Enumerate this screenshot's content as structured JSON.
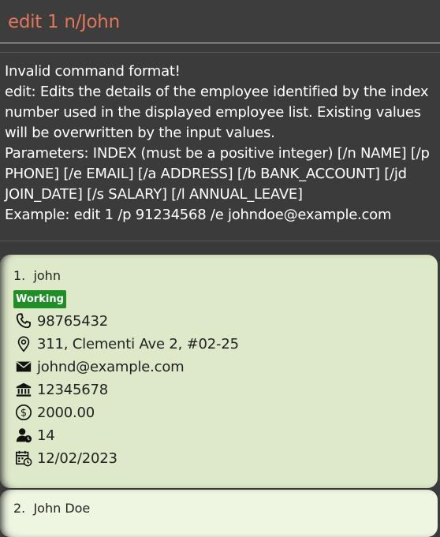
{
  "command_box": {
    "input_value": "edit 1 n/John"
  },
  "result_display": {
    "text": "Invalid command format!\nedit: Edits the details of the employee identified by the index number used in the displayed employee list. Existing values will be overwritten by the input values.\nParameters: INDEX (must be a positive integer) [/n NAME] [/p PHONE] [/e EMAIL] [/a ADDRESS] [/b BANK_ACCOUNT] [/jd JOIN_DATE] [/s SALARY] [/l ANNUAL_LEAVE]\nExample: edit 1 /p 91234568 /e johndoe@example.com"
  },
  "employees": [
    {
      "index": "1.",
      "name": "john",
      "status": "Working",
      "phone": "98765432",
      "address": "311, Clementi Ave 2, #02-25",
      "email": "johnd@example.com",
      "bank_account": "12345678",
      "salary": "2000.00",
      "annual_leave": "14",
      "join_date": "12/02/2023",
      "icons": [
        "phone-icon",
        "location-icon",
        "mail-icon",
        "bank-icon",
        "dollar-icon",
        "leave-icon",
        "calendar-icon"
      ]
    },
    {
      "index": "2.",
      "name": "John Doe"
    }
  ],
  "colors": {
    "command_text": "#e2765a",
    "badge_bg": "#1f8e27",
    "card_bg": "#dee9c9",
    "app_bg": "#3a3a3a"
  }
}
